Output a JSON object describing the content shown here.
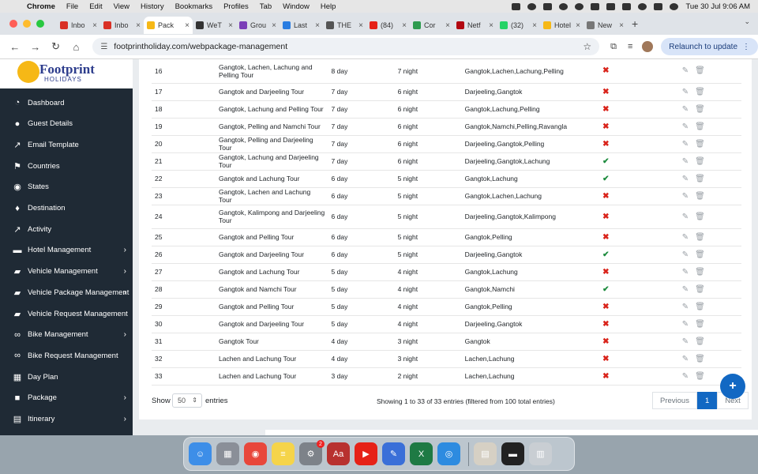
{
  "menubar": {
    "items": [
      "Chrome",
      "File",
      "Edit",
      "View",
      "History",
      "Bookmarks",
      "Profiles",
      "Tab",
      "Window",
      "Help"
    ],
    "clock": "Tue 30 Jul  9:06 AM"
  },
  "tabs": [
    {
      "label": "Inbo",
      "color": "#d93025"
    },
    {
      "label": "Inbo",
      "color": "#d93025"
    },
    {
      "label": "Pack",
      "color": "#f6b816"
    },
    {
      "label": "WeT",
      "color": "#333333"
    },
    {
      "label": "Grou",
      "color": "#7b3fb8"
    },
    {
      "label": "Last",
      "color": "#2a7de1"
    },
    {
      "label": "THE",
      "color": "#555555"
    },
    {
      "label": "(84)",
      "color": "#e62117"
    },
    {
      "label": "Cor",
      "color": "#2e9b4f"
    },
    {
      "label": "Netf",
      "color": "#b20710"
    },
    {
      "label": "(32)",
      "color": "#25d366"
    },
    {
      "label": "Hotel",
      "color": "#f6b816"
    },
    {
      "label": "New",
      "color": "#777777"
    }
  ],
  "address": {
    "url": "footprintholiday.com/webpackage-management",
    "relaunch": "Relaunch to update"
  },
  "logo": {
    "title": "Footprint",
    "subtitle": "HOLIDAYS"
  },
  "sidebar": {
    "items": [
      {
        "label": "Dashboard",
        "icon": "dashboard-icon",
        "glyph": "◔",
        "arrow": ""
      },
      {
        "label": "Guest Details",
        "icon": "user-icon",
        "glyph": "●",
        "arrow": ""
      },
      {
        "label": "Email Template",
        "icon": "chart-icon",
        "glyph": "↗",
        "arrow": ""
      },
      {
        "label": "Countries",
        "icon": "flag-icon",
        "glyph": "⚑",
        "arrow": ""
      },
      {
        "label": "States",
        "icon": "globe-icon",
        "glyph": "◉",
        "arrow": ""
      },
      {
        "label": "Destination",
        "icon": "map-pin-icon",
        "glyph": "♦",
        "arrow": ""
      },
      {
        "label": "Activity",
        "icon": "chart-icon",
        "glyph": "↗",
        "arrow": ""
      },
      {
        "label": "Hotel Management",
        "icon": "bed-icon",
        "glyph": "▬",
        "arrow": "›"
      },
      {
        "label": "Vehicle Management",
        "icon": "car-icon",
        "glyph": "▰",
        "arrow": "›"
      },
      {
        "label": "Vehicle Package Management",
        "icon": "car-icon",
        "glyph": "▰",
        "arrow": "›"
      },
      {
        "label": "Vehicle Request Management",
        "icon": "car-icon",
        "glyph": "▰",
        "arrow": ""
      },
      {
        "label": "Bike Management",
        "icon": "bike-icon",
        "glyph": "∞",
        "arrow": "›"
      },
      {
        "label": "Bike Request Management",
        "icon": "bike-icon",
        "glyph": "∞",
        "arrow": ""
      },
      {
        "label": "Day Plan",
        "icon": "calendar-icon",
        "glyph": "▦",
        "arrow": ""
      },
      {
        "label": "Package",
        "icon": "box-icon",
        "glyph": "■",
        "arrow": "›"
      },
      {
        "label": "Itinerary",
        "icon": "book-icon",
        "glyph": "▤",
        "arrow": "›"
      }
    ]
  },
  "table": {
    "rows": [
      {
        "id": "16",
        "name": "Gangtok, Lachen, Lachung and Pelling Tour",
        "days": "8 day",
        "nights": "7 night",
        "places": "Gangtok,Lachen,Lachung,Pelling",
        "status": "no",
        "tall": true
      },
      {
        "id": "17",
        "name": "Gangtok and Darjeeling Tour",
        "days": "7 day",
        "nights": "6 night",
        "places": "Darjeeling,Gangtok",
        "status": "no",
        "tall": false
      },
      {
        "id": "18",
        "name": "Gangtok, Lachung and Pelling Tour",
        "days": "7 day",
        "nights": "6 night",
        "places": "Gangtok,Lachung,Pelling",
        "status": "no",
        "tall": false
      },
      {
        "id": "19",
        "name": "Gangtok, Pelling and Namchi Tour",
        "days": "7 day",
        "nights": "6 night",
        "places": "Gangtok,Namchi,Pelling,Ravangla",
        "status": "no",
        "tall": false
      },
      {
        "id": "20",
        "name": "Gangtok, Pelling and Darjeeling Tour",
        "days": "7 day",
        "nights": "6 night",
        "places": "Darjeeling,Gangtok,Pelling",
        "status": "no",
        "tall": false
      },
      {
        "id": "21",
        "name": "Gangtok, Lachung and Darjeeling Tour",
        "days": "7 day",
        "nights": "6 night",
        "places": "Darjeeling,Gangtok,Lachung",
        "status": "yes",
        "tall": false
      },
      {
        "id": "22",
        "name": "Gangtok and Lachung Tour",
        "days": "6 day",
        "nights": "5 night",
        "places": "Gangtok,Lachung",
        "status": "yes",
        "tall": false
      },
      {
        "id": "23",
        "name": "Gangtok, Lachen and Lachung Tour",
        "days": "6 day",
        "nights": "5 night",
        "places": "Gangtok,Lachen,Lachung",
        "status": "no",
        "tall": false
      },
      {
        "id": "24",
        "name": "Gangtok, Kalimpong and Darjeeling Tour",
        "days": "6 day",
        "nights": "5 night",
        "places": "Darjeeling,Gangtok,Kalimpong",
        "status": "no",
        "tall": true
      },
      {
        "id": "25",
        "name": "Gangtok and Pelling Tour",
        "days": "6 day",
        "nights": "5 night",
        "places": "Gangtok,Pelling",
        "status": "no",
        "tall": false
      },
      {
        "id": "26",
        "name": "Gangtok and Darjeeling Tour",
        "days": "6 day",
        "nights": "5 night",
        "places": "Darjeeling,Gangtok",
        "status": "yes",
        "tall": false
      },
      {
        "id": "27",
        "name": "Gangtok and Lachung Tour",
        "days": "5 day",
        "nights": "4 night",
        "places": "Gangtok,Lachung",
        "status": "no",
        "tall": false
      },
      {
        "id": "28",
        "name": "Gangtok and Namchi Tour",
        "days": "5 day",
        "nights": "4 night",
        "places": "Gangtok,Namchi",
        "status": "yes",
        "tall": false
      },
      {
        "id": "29",
        "name": "Gangtok and Pelling Tour",
        "days": "5 day",
        "nights": "4 night",
        "places": "Gangtok,Pelling",
        "status": "no",
        "tall": false
      },
      {
        "id": "30",
        "name": "Gangtok and Darjeeling Tour",
        "days": "5 day",
        "nights": "4 night",
        "places": "Darjeeling,Gangtok",
        "status": "no",
        "tall": false
      },
      {
        "id": "31",
        "name": "Gangtok Tour",
        "days": "4 day",
        "nights": "3 night",
        "places": "Gangtok",
        "status": "no",
        "tall": false
      },
      {
        "id": "32",
        "name": "Lachen and Lachung Tour",
        "days": "4 day",
        "nights": "3 night",
        "places": "Lachen,Lachung",
        "status": "no",
        "tall": false
      },
      {
        "id": "33",
        "name": "Lachen and Lachung Tour",
        "days": "3 day",
        "nights": "2 night",
        "places": "Lachen,Lachung",
        "status": "no",
        "tall": false
      }
    ],
    "status_glyphs": {
      "yes": "✔",
      "no": "✖"
    }
  },
  "footer": {
    "show": "Show",
    "page_size": "50",
    "entries": "entries",
    "info": "Showing 1 to 33 of 33 entries (filtered from 100 total entries)",
    "prev": "Previous",
    "page": "1",
    "next": "Next"
  },
  "fab": "+",
  "dock": {
    "apps": [
      {
        "name": "finder",
        "color": "#3d8ee8",
        "glyph": "☺"
      },
      {
        "name": "launchpad",
        "color": "#8a8f98",
        "glyph": "▦"
      },
      {
        "name": "chrome",
        "color": "#e8473b",
        "glyph": "◉"
      },
      {
        "name": "notes",
        "color": "#f5d44a",
        "glyph": "≡"
      },
      {
        "name": "system-settings",
        "color": "#7d8289",
        "glyph": "⚙",
        "badge": "2"
      },
      {
        "name": "dictionary",
        "color": "#b8312f",
        "glyph": "Aa"
      },
      {
        "name": "youtube-music",
        "color": "#e62117",
        "glyph": "▶"
      },
      {
        "name": "pen-app",
        "color": "#3a6fd8",
        "glyph": "✎"
      },
      {
        "name": "excel",
        "color": "#1e7a44",
        "glyph": "X"
      },
      {
        "name": "safari",
        "color": "#2d8be0",
        "glyph": "◎"
      },
      {
        "name": "downloads",
        "color": "#d6d0c4",
        "glyph": "▤"
      },
      {
        "name": "screen-recorder",
        "color": "#222222",
        "glyph": "▬"
      },
      {
        "name": "trash",
        "color": "#c9ced3",
        "glyph": "▥"
      }
    ]
  }
}
